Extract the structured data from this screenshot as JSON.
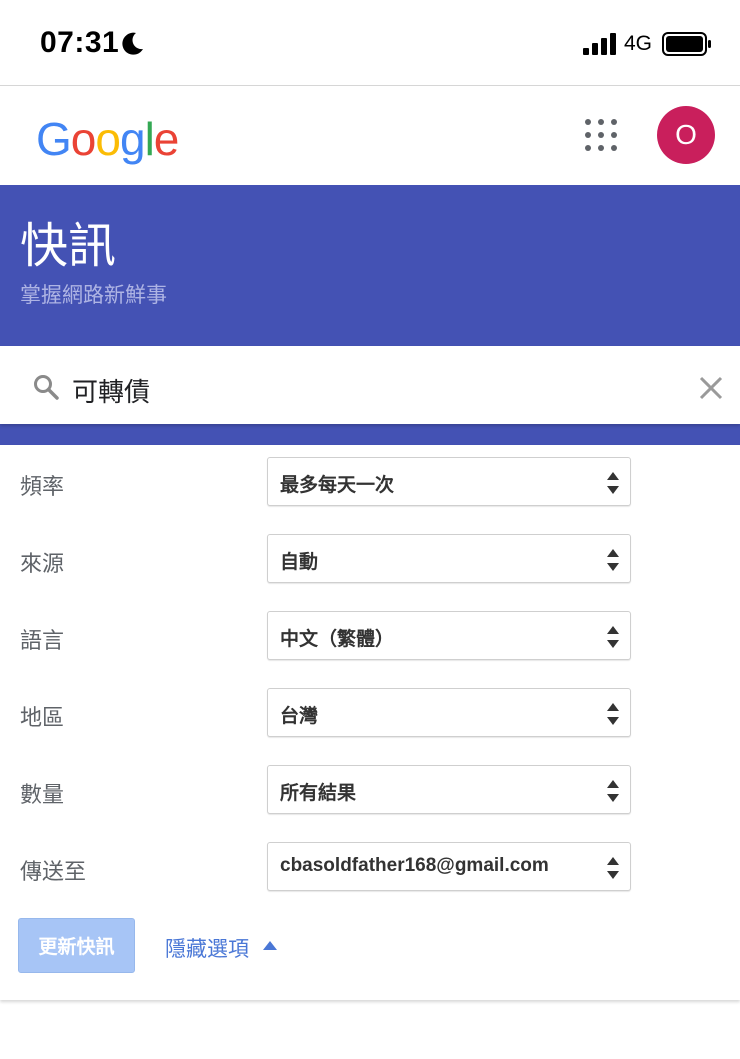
{
  "status_bar": {
    "time": "07:31",
    "network": "4G",
    "icons": [
      "moon-icon",
      "signal-icon",
      "battery-icon"
    ]
  },
  "header": {
    "logo_text": "Google",
    "avatar_letter": "O",
    "icons": [
      "apps-icon"
    ],
    "avatar_color": "#c91f5c"
  },
  "banner": {
    "title": "快訊",
    "subtitle": "掌握網路新鮮事",
    "color": "#4452b4"
  },
  "search": {
    "value": "可轉債",
    "icons": [
      "search-icon",
      "close-icon"
    ]
  },
  "options": [
    {
      "label": "頻率",
      "value": "最多每天一次"
    },
    {
      "label": "來源",
      "value": "自動"
    },
    {
      "label": "語言",
      "value": "中文（繁體）"
    },
    {
      "label": "地區",
      "value": "台灣"
    },
    {
      "label": "數量",
      "value": "所有結果"
    },
    {
      "label": "傳送至",
      "value": "cbasoldfather168@gmail.com"
    }
  ],
  "actions": {
    "update_label": "更新快訊",
    "hide_options_label": "隱藏選項"
  }
}
